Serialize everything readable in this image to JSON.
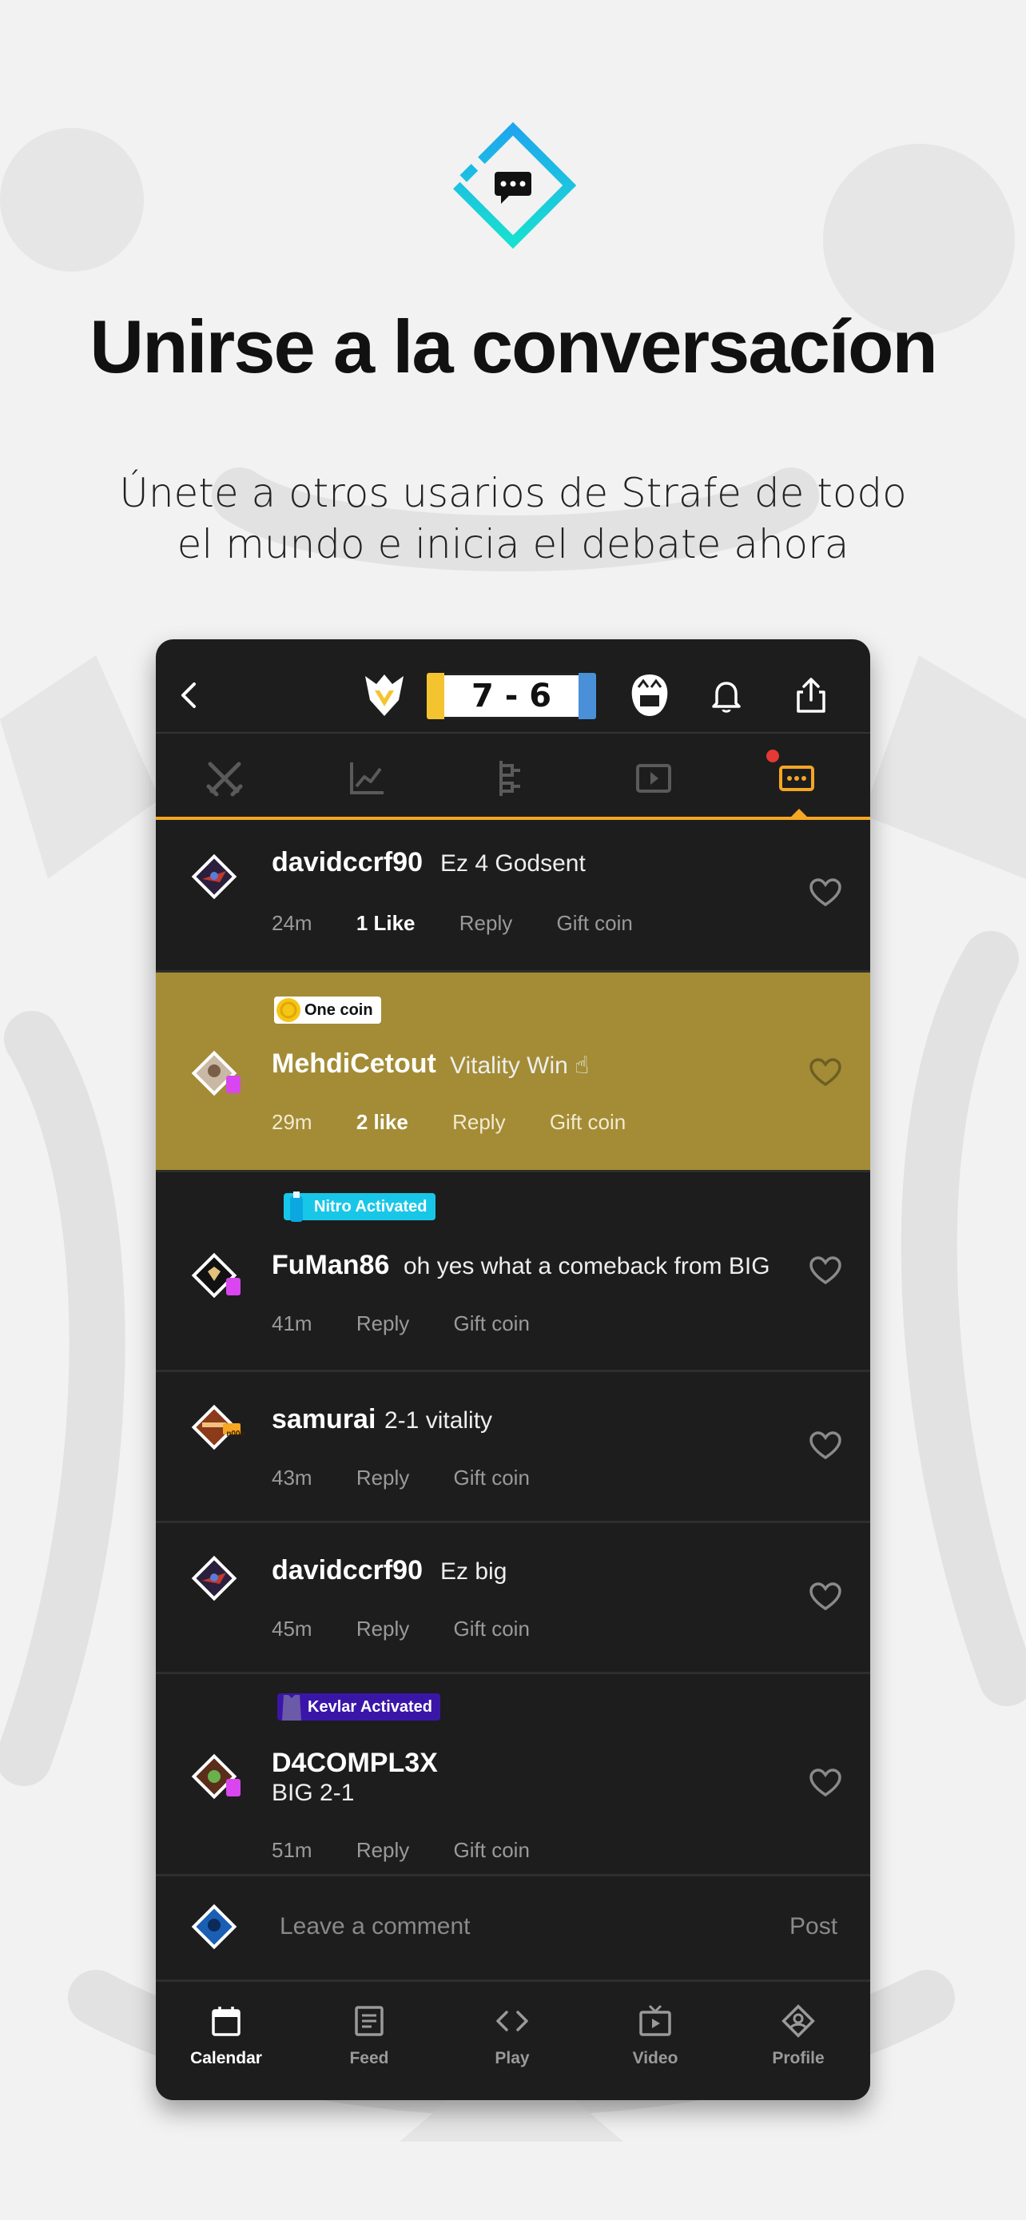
{
  "promo": {
    "headline": "Unirse a la conversacíon",
    "subline": "Únete a otros usarios de Strafe de todo el mundo e inicia el debate ahora"
  },
  "match": {
    "score": "7 - 6",
    "home_color": "#f4c430",
    "away_color": "#4a90d9"
  },
  "comments": [
    {
      "user": "davidccrf90",
      "text": "Ez 4 Godsent",
      "time": "24m",
      "likes": "1 Like",
      "reply": "Reply",
      "gift": "Gift coin"
    },
    {
      "user": "MehdiCetout",
      "text": "Vitality Win ☝",
      "time": "29m",
      "likes": "2 like",
      "reply": "Reply",
      "gift": "Gift coin",
      "badge": "One coin"
    },
    {
      "user": "FuMan86",
      "text": "oh yes what a comeback from BIG",
      "time": "41m",
      "reply": "Reply",
      "gift": "Gift coin",
      "badge": "Nitro Activated"
    },
    {
      "user": "samurai",
      "text": "2-1 vitality",
      "time": "43m",
      "reply": "Reply",
      "gift": "Gift coin",
      "rank": "n00b"
    },
    {
      "user": "davidccrf90",
      "text": "Ez big",
      "time": "45m",
      "reply": "Reply",
      "gift": "Gift coin"
    },
    {
      "user": "D4COMPL3X",
      "text": "BIG 2-1",
      "time": "51m",
      "reply": "Reply",
      "gift": "Gift coin",
      "badge": "Kevlar Activated"
    }
  ],
  "compose": {
    "placeholder": "Leave a comment",
    "post_label": "Post"
  },
  "nav": [
    {
      "label": "Calendar",
      "icon": "calendar-icon",
      "active": true
    },
    {
      "label": "Feed",
      "icon": "feed-icon"
    },
    {
      "label": "Play",
      "icon": "code-icon"
    },
    {
      "label": "Video",
      "icon": "tv-icon"
    },
    {
      "label": "Profile",
      "icon": "profile-icon"
    }
  ],
  "colors": {
    "accent": "#f5a623",
    "highlight_row": "#a38c35",
    "brand_teal": "#18d7e0",
    "brand_blue": "#1fa6ee"
  }
}
